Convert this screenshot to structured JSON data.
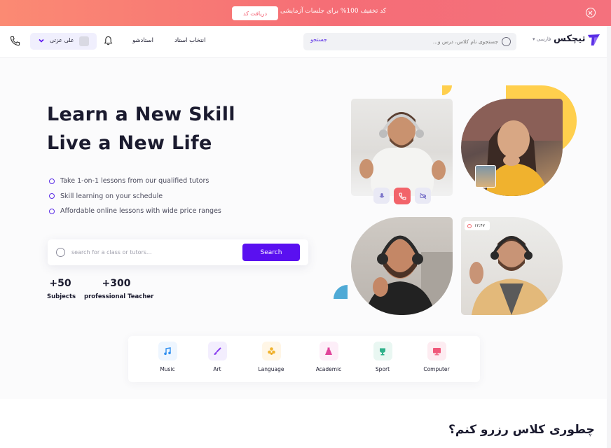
{
  "promo": {
    "text": "کد تخفیف 100% برای جلسات آزمایشی",
    "cta": "دریافت کد"
  },
  "header": {
    "logo": "تیچکس",
    "language": "فارسی",
    "search_placeholder": "جستجوی نام کلاس، درس و...",
    "search_button": "جستجو",
    "nav": [
      "انتخاب استاد",
      "استادشو"
    ],
    "user_name": "علی عزتی"
  },
  "hero": {
    "title_line1": "Learn a New Skill",
    "title_line2": "Live a New Life",
    "bullets": [
      "Take 1-on-1 lessons from our qualified tutors",
      "Skill learning on your schedule",
      "Affordable online lessons with wide price ranges"
    ],
    "search_placeholder": "search for a class or tutors...",
    "search_button": "Search",
    "stats": [
      {
        "value": "+50",
        "label": "Subjects"
      },
      {
        "value": "+300",
        "label": "professional Teacher"
      }
    ],
    "recording_time": "۱۲:۴۷"
  },
  "categories": [
    {
      "label": "Music",
      "icon": "music-note-icon",
      "bg": "#eef6ff",
      "color": "#2f8ff0"
    },
    {
      "label": "Art",
      "icon": "brush-icon",
      "bg": "#f3eefe",
      "color": "#8a3ff0"
    },
    {
      "label": "Language",
      "icon": "language-icon",
      "bg": "#fff6e6",
      "color": "#f0b32f"
    },
    {
      "label": "Academic",
      "icon": "flask-icon",
      "bg": "#fdeef8",
      "color": "#e0449a"
    },
    {
      "label": "Sport",
      "icon": "trophy-icon",
      "bg": "#e9f7f2",
      "color": "#2fb08a"
    },
    {
      "label": "Computer",
      "icon": "monitor-icon",
      "bg": "#fdecf1",
      "color": "#f0587a"
    }
  ],
  "how_section": {
    "title": "چطوری کلاس رزرو کنم؟"
  },
  "colors": {
    "primary": "#5a10f0",
    "promo": "#f56d76",
    "accent_yellow": "#ffcf4d",
    "accent_blue": "#4faad6"
  }
}
